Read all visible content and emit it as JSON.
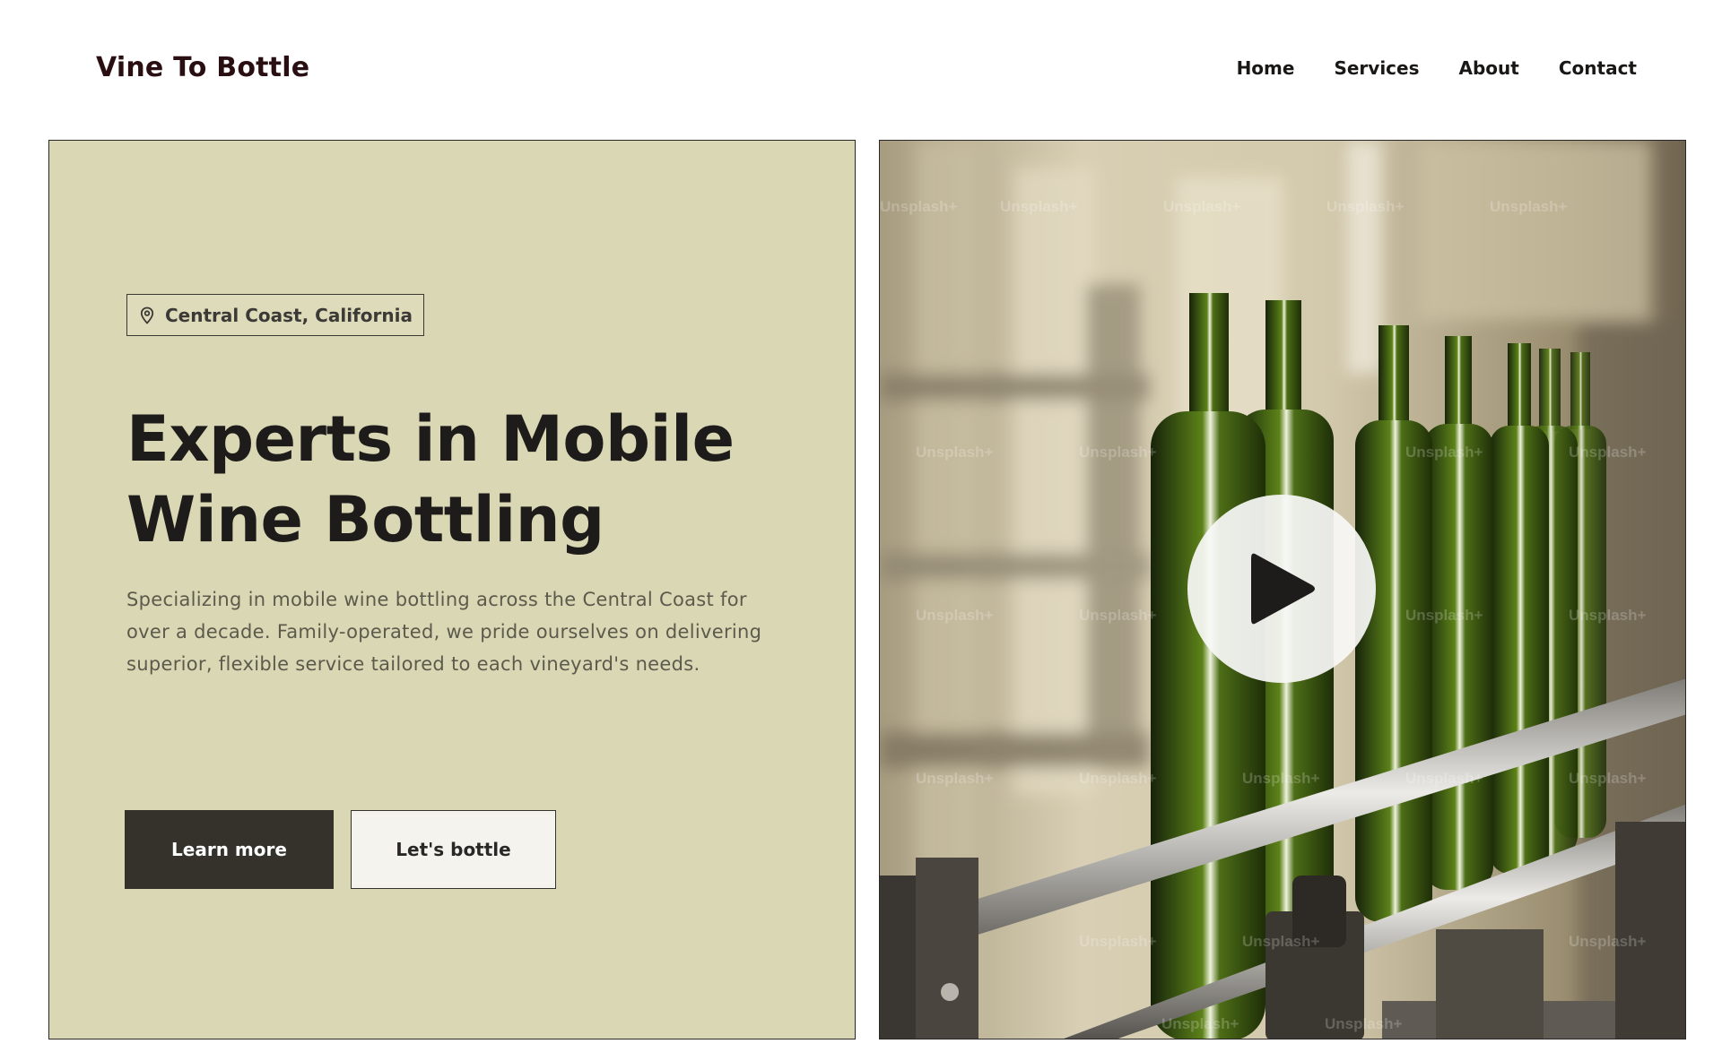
{
  "header": {
    "brand": "Vine To Bottle",
    "nav": [
      "Home",
      "Services",
      "About",
      "Contact"
    ]
  },
  "hero": {
    "location": "Central Coast, California",
    "location_icon": "map-pin-icon",
    "title": "Experts in Mobile Wine Bottling",
    "description": "Specializing in mobile wine bottling across the Central Coast for over a decade. Family-operated, we pride ourselves on delivering superior, flexible service tailored to each vineyard's needs.",
    "primary_button": "Learn more",
    "secondary_button": "Let's bottle"
  },
  "media": {
    "watermark": "Unsplash+",
    "play_icon": "play-icon"
  },
  "colors": {
    "hero_background": "#dad7b4",
    "primary_button": "#35322c",
    "secondary_button": "#f5f3ee",
    "brand": "#2a0f12"
  }
}
